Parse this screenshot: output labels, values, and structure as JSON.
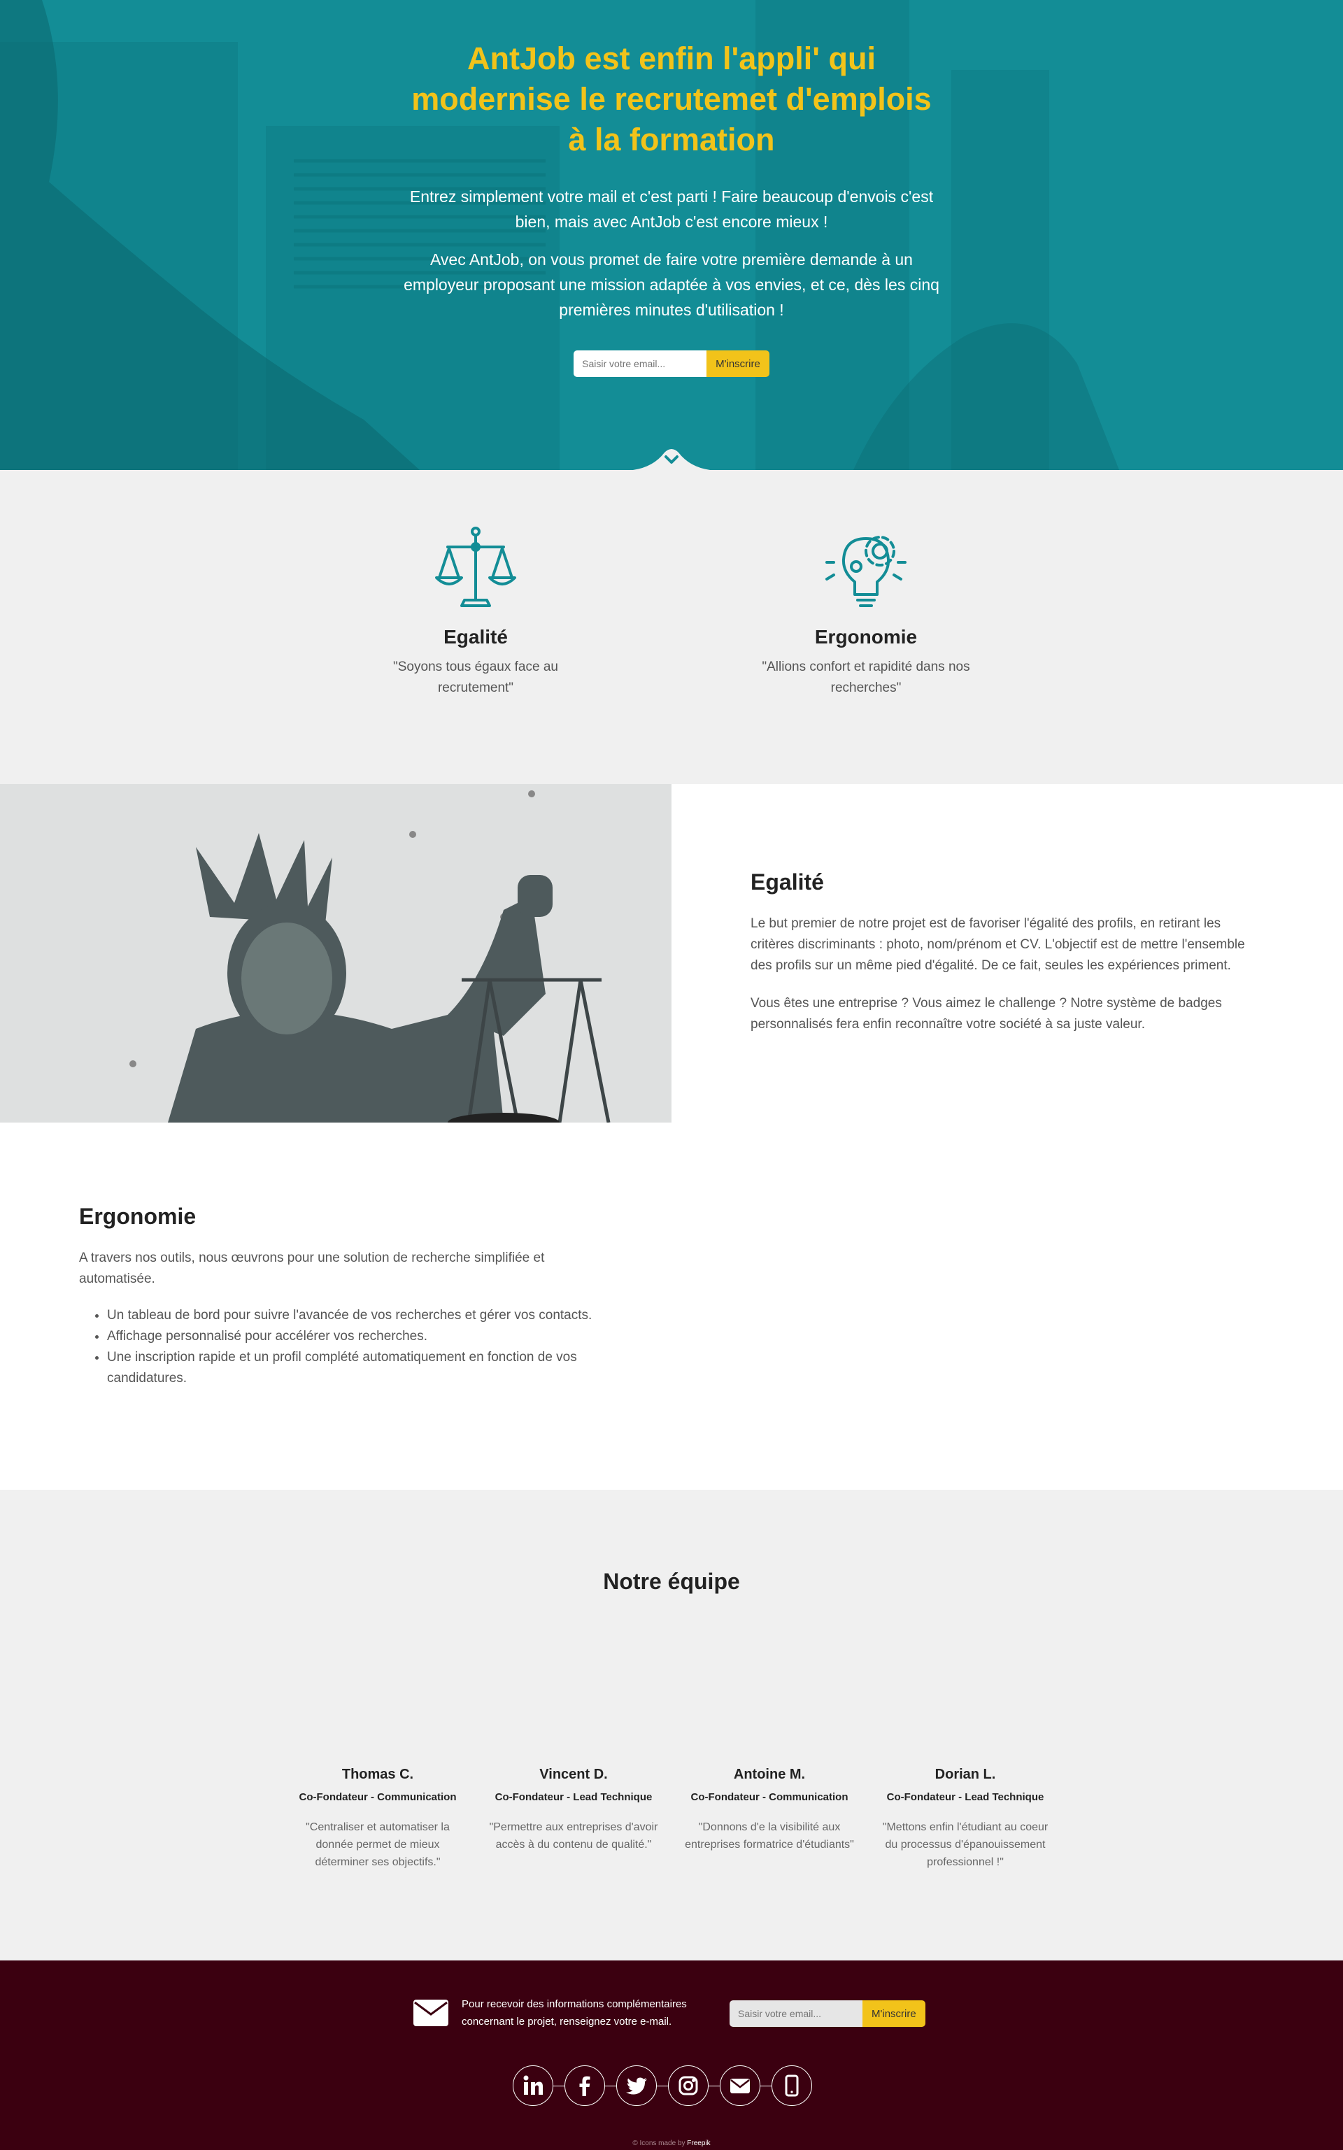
{
  "hero": {
    "title": "AntJob est enfin l'appli' qui modernise le recrutemet d'emplois à la formation",
    "p1": "Entrez simplement votre mail et c'est parti ! Faire beaucoup d'envois c'est bien, mais avec AntJob c'est encore mieux !",
    "p2": "Avec AntJob, on vous promet de faire votre première demande à un employeur proposant une mission adaptée à vos envies, et ce, dès les cinq premières minutes d'utilisation !",
    "email_placeholder": "Saisir votre email...",
    "subscribe_label": "M'inscrire",
    "scroll_icon": "chevron-down-icon"
  },
  "features": [
    {
      "icon": "scales-icon",
      "title": "Egalité",
      "quote": "\"Soyons tous égaux face au recrutement\""
    },
    {
      "icon": "lightbulb-gear-icon",
      "title": "Ergonomie",
      "quote": "\"Allions confort et rapidité dans nos recherches\""
    }
  ],
  "egalite": {
    "title": "Egalité",
    "p1": "Le but premier de notre projet est de favoriser l'égalité des profils, en retirant les critères discriminants : photo, nom/prénom et CV. L'objectif est de mettre l'ensemble des profils sur un même pied d'égalité. De ce fait, seules les expériences priment.",
    "p2": "Vous êtes une entreprise ? Vous aimez le challenge ? Notre système de badges personnalisés fera enfin reconnaître votre société à sa juste valeur."
  },
  "ergonomie": {
    "title": "Ergonomie",
    "intro": "A travers nos outils, nous œuvrons pour une solution de recherche simplifiée et automatisée.",
    "items": [
      "Un tableau de bord pour suivre l'avancée de vos recherches et gérer vos contacts.",
      "Affichage personnalisé pour accélérer vos recherches.",
      "Une inscription rapide et un profil complété automatiquement en fonction de vos candidatures."
    ]
  },
  "team": {
    "title": "Notre équipe",
    "members": [
      {
        "name": "Thomas C.",
        "role": "Co-Fondateur - Communication",
        "quote": "\"Centraliser et automatiser la donnée permet de mieux déterminer ses objectifs.\""
      },
      {
        "name": "Vincent D.",
        "role": "Co-Fondateur - Lead Technique",
        "quote": "\"Permettre aux entreprises d'avoir accès à du contenu de qualité.\""
      },
      {
        "name": "Antoine M.",
        "role": "Co-Fondateur - Communication",
        "quote": "\"Donnons d'e la visibilité aux entreprises formatrice d'étudiants\""
      },
      {
        "name": "Dorian L.",
        "role": "Co-Fondateur - Lead Technique",
        "quote": "\"Mettons enfin l'étudiant au coeur du processus d'épanouissement professionnel !\""
      }
    ]
  },
  "footer": {
    "newsletter_text": "Pour recevoir des informations complémentaires concernant le projet, renseignez votre e-mail.",
    "email_placeholder": "Saisir votre email...",
    "subscribe_label": "M'inscrire",
    "socials": [
      "linkedin-icon",
      "facebook-icon",
      "twitter-icon",
      "instagram-icon",
      "email-icon",
      "phone-icon"
    ],
    "credit_prefix": "© Icons made by",
    "credit_brand": "Freepik"
  },
  "colors": {
    "teal": "#138d96",
    "yellow": "#f2c31a",
    "footer": "#3b0010",
    "light": "#f0f0f0"
  }
}
